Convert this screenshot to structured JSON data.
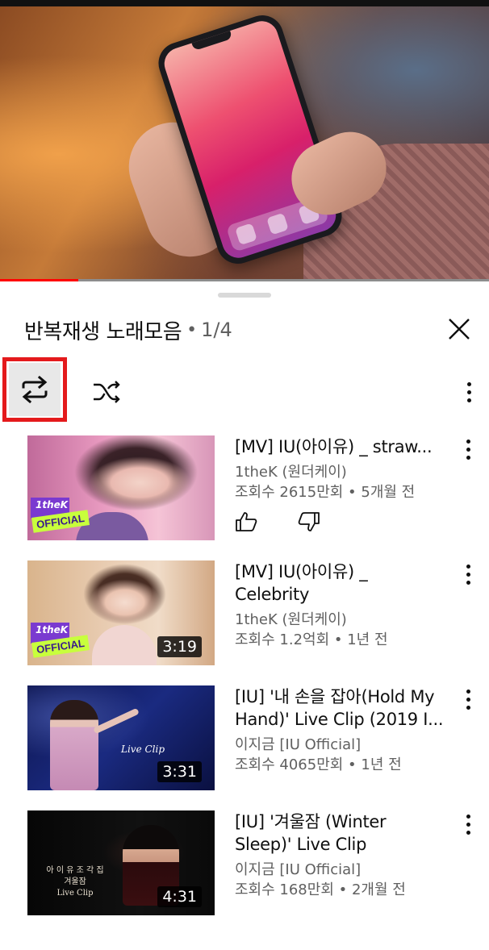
{
  "video": {
    "progress_fraction": 0.16
  },
  "playlist": {
    "title": "반복재생 노래모음",
    "separator": "•",
    "position": "1/4"
  },
  "controls": {
    "loop_icon": "repeat-icon",
    "shuffle_icon": "shuffle-icon",
    "more_icon": "more-vertical-icon",
    "close_icon": "close-icon",
    "highlight_color": "#e41a1c"
  },
  "items": [
    {
      "title": "[MV] IU(아이유) _ straw...",
      "channel": "1theK (원더케이)",
      "meta": "조회수 2615만회 • 5개월 전",
      "duration": "",
      "logo_k": "1theK",
      "logo_official": "OFFICIAL",
      "show_likes": true
    },
    {
      "title": "[MV] IU(아이유) _ Celebrity",
      "channel": "1theK (원더케이)",
      "meta": "조회수 1.2억회 • 1년 전",
      "duration": "3:19",
      "logo_k": "1theK",
      "logo_official": "OFFICIAL"
    },
    {
      "title": "[IU] '내 손을 잡아(Hold My Hand)' Live Clip (2019 I...",
      "channel": "이지금 [IU Official]",
      "meta": "조회수 4065만회 • 1년 전",
      "duration": "3:31",
      "thumb_text": "Live Clip"
    },
    {
      "title": "[IU] '겨울잠 (Winter Sleep)' Live Clip",
      "channel": "이지금 [IU Official]",
      "meta": "조회수 168만회 • 2개월 전",
      "duration": "4:31",
      "thumb_lines": [
        "아 이 유 조 각 집",
        "겨울잠",
        "Live Clip"
      ]
    }
  ]
}
